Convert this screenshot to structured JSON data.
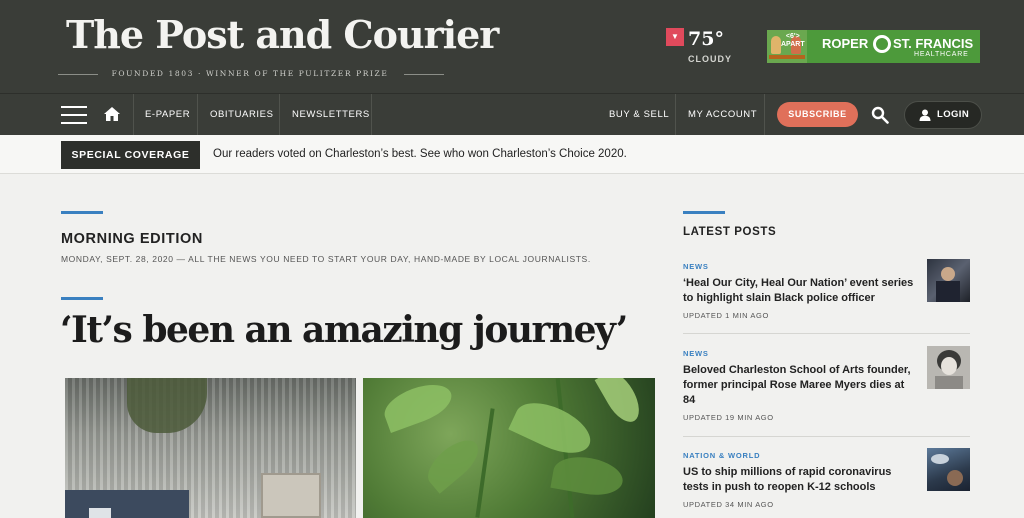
{
  "masthead": {
    "logo_text": "The Post and Courier",
    "tagline": "FOUNDED 1803 · WINNER OF THE PULITZER PRIZE",
    "weather": {
      "temperature": "75°",
      "condition": "CLOUDY"
    },
    "ad": {
      "apart_top": "<6'>",
      "apart_bottom": "APART",
      "brand_left": "ROPER",
      "brand_right": "ST. FRANCIS",
      "brand_sub": "HEALTHCARE"
    }
  },
  "nav": {
    "left_links": [
      "E-PAPER",
      "OBITUARIES",
      "NEWSLETTERS"
    ],
    "right_links": [
      "BUY & SELL",
      "MY ACCOUNT"
    ],
    "subscribe_label": "SUBSCRIBE",
    "login_label": "LOGIN"
  },
  "special_coverage": {
    "badge": "SPECIAL COVERAGE",
    "text": "Our readers voted on Charleston’s best. See who won Charleston’s Choice 2020."
  },
  "main": {
    "edition_title": "MORNING EDITION",
    "edition_subtitle": "MONDAY, SEPT. 28, 2020 — ALL THE NEWS YOU NEED TO START YOUR DAY, HAND-MADE BY LOCAL JOURNALISTS.",
    "headline": "‘It’s been an amazing journey’"
  },
  "sidebar": {
    "title": "LATEST POSTS",
    "posts": [
      {
        "category": "NEWS",
        "title": "‘Heal Our City, Heal Our Nation’ event series to highlight slain Black police officer",
        "time": "UPDATED 1 MIN AGO"
      },
      {
        "category": "NEWS",
        "title": "Beloved Charleston School of Arts founder, former principal Rose Maree Myers dies at 84",
        "time": "UPDATED 19 MIN AGO"
      },
      {
        "category": "NATION & WORLD",
        "title": "US to ship millions of rapid coronavirus tests in push to reopen K-12 schools",
        "time": "UPDATED 34 MIN AGO"
      }
    ]
  },
  "colors": {
    "header_bg": "#3a3d38",
    "accent_blue": "#3a80c0",
    "subscribe": "#e0705a",
    "weather_flag": "#e04a5c",
    "ad_green": "#4d9a3b"
  },
  "icons": [
    "menu-icon",
    "home-icon",
    "search-icon",
    "user-icon",
    "alert-flag-icon"
  ]
}
